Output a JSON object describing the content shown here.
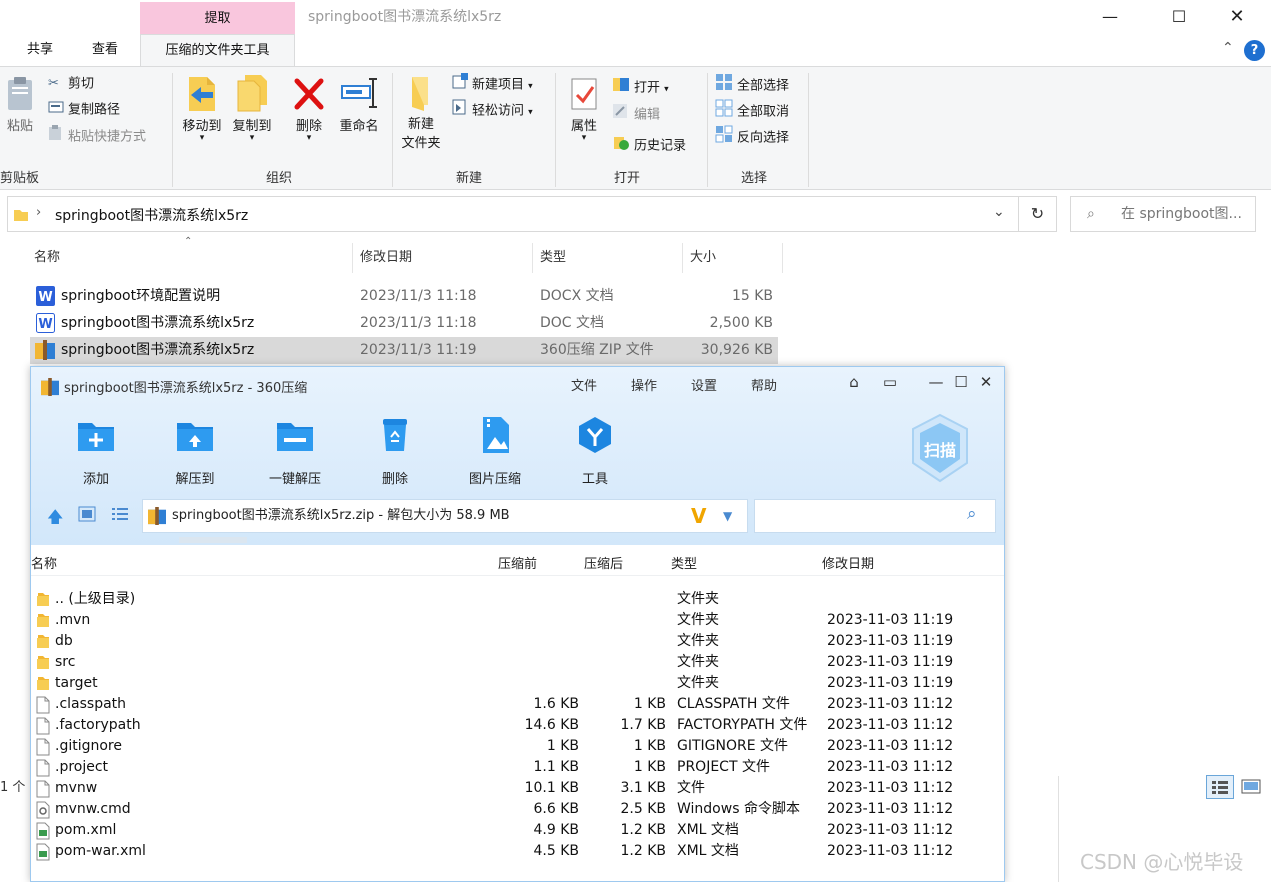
{
  "explorer": {
    "context_tab": "提取",
    "window_title": "springboot图书漂流系统lx5rz",
    "tabs": [
      "共享",
      "查看",
      "压缩的文件夹工具"
    ],
    "ribbon": {
      "clipboard": {
        "paste": "粘贴",
        "cut": "剪切",
        "copy_path": "复制路径",
        "paste_shortcut": "粘贴快捷方式",
        "group": "剪贴板"
      },
      "organize": {
        "move_to": "移动到",
        "copy_to": "复制到",
        "delete": "删除",
        "rename": "重命名",
        "group": "组织"
      },
      "new": {
        "new_folder_1": "新建",
        "new_folder_2": "文件夹",
        "new_item": "新建项目",
        "easy_access": "轻松访问",
        "group": "新建"
      },
      "open": {
        "properties": "属性",
        "open": "打开",
        "edit": "编辑",
        "history": "历史记录",
        "group": "打开"
      },
      "select": {
        "select_all": "全部选择",
        "select_none": "全部取消",
        "invert": "反向选择",
        "group": "选择"
      }
    },
    "address": "springboot图书漂流系统lx5rz",
    "search_placeholder": "在 springboot图...",
    "columns": {
      "name": "名称",
      "date": "修改日期",
      "type": "类型",
      "size": "大小"
    },
    "files": [
      {
        "name": "springboot环境配置说明",
        "date": "2023/11/3 11:18",
        "type": "DOCX 文档",
        "size": "15 KB"
      },
      {
        "name": "springboot图书漂流系统lx5rz",
        "date": "2023/11/3 11:18",
        "type": "DOC 文档",
        "size": "2,500 KB"
      },
      {
        "name": "springboot图书漂流系统lx5rz",
        "date": "2023/11/3 11:19",
        "type": "360压缩 ZIP 文件",
        "size": "30,926 KB"
      }
    ],
    "status": "1 个"
  },
  "zip": {
    "title": "springboot图书漂流系统lx5rz - 360压缩",
    "menu": [
      "文件",
      "操作",
      "设置",
      "帮助"
    ],
    "tools": [
      "添加",
      "解压到",
      "一键解压",
      "删除",
      "图片压缩",
      "工具"
    ],
    "scan": "扫描",
    "path": "springboot图书漂流系统lx5rz.zip - 解包大小为 58.9 MB",
    "columns": {
      "name": "名称",
      "before": "压缩前",
      "after": "压缩后",
      "type": "类型",
      "date": "修改日期"
    },
    "rows": [
      {
        "name": ".. (上级目录)",
        "before": "",
        "after": "",
        "type": "文件夹",
        "date": "",
        "icon": "folder"
      },
      {
        "name": ".mvn",
        "before": "",
        "after": "",
        "type": "文件夹",
        "date": "2023-11-03 11:19",
        "icon": "folder"
      },
      {
        "name": "db",
        "before": "",
        "after": "",
        "type": "文件夹",
        "date": "2023-11-03 11:19",
        "icon": "folder"
      },
      {
        "name": "src",
        "before": "",
        "after": "",
        "type": "文件夹",
        "date": "2023-11-03 11:19",
        "icon": "folder"
      },
      {
        "name": "target",
        "before": "",
        "after": "",
        "type": "文件夹",
        "date": "2023-11-03 11:19",
        "icon": "folder"
      },
      {
        "name": ".classpath",
        "before": "1.6 KB",
        "after": "1 KB",
        "type": "CLASSPATH 文件",
        "date": "2023-11-03 11:12",
        "icon": "file"
      },
      {
        "name": ".factorypath",
        "before": "14.6 KB",
        "after": "1.7 KB",
        "type": "FACTORYPATH 文件",
        "date": "2023-11-03 11:12",
        "icon": "file"
      },
      {
        "name": ".gitignore",
        "before": "1 KB",
        "after": "1 KB",
        "type": "GITIGNORE 文件",
        "date": "2023-11-03 11:12",
        "icon": "file"
      },
      {
        "name": ".project",
        "before": "1.1 KB",
        "after": "1 KB",
        "type": "PROJECT 文件",
        "date": "2023-11-03 11:12",
        "icon": "file"
      },
      {
        "name": "mvnw",
        "before": "10.1 KB",
        "after": "3.1 KB",
        "type": "文件",
        "date": "2023-11-03 11:12",
        "icon": "file"
      },
      {
        "name": "mvnw.cmd",
        "before": "6.6 KB",
        "after": "2.5 KB",
        "type": "Windows 命令脚本",
        "date": "2023-11-03 11:12",
        "icon": "cmd"
      },
      {
        "name": "pom.xml",
        "before": "4.9 KB",
        "after": "1.2 KB",
        "type": "XML 文档",
        "date": "2023-11-03 11:12",
        "icon": "xml"
      },
      {
        "name": "pom-war.xml",
        "before": "4.5 KB",
        "after": "1.2 KB",
        "type": "XML 文档",
        "date": "2023-11-03 11:12",
        "icon": "xml"
      }
    ]
  },
  "watermark": "CSDN @心悦毕设"
}
